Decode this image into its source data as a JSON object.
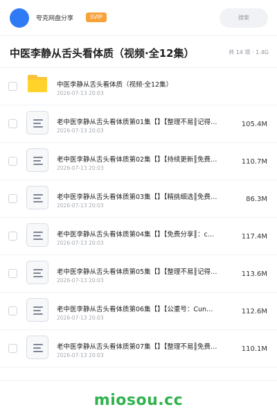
{
  "header": {
    "username": "夸克网盘分享",
    "vip_badge": "SVIP",
    "search_placeholder": "搜索"
  },
  "page": {
    "title": "中医李静从舌头看体质（视频·全12集）",
    "meta": "共 14 项 · 1.4G"
  },
  "rows": [
    {
      "type": "folder",
      "name": "中医李静从舌头看体质（视频·全12集）",
      "date": "2026-07-13 20:03",
      "size": ""
    },
    {
      "type": "file",
      "name": "老中医李静从舌头看体质第01集【】【整理不易║记得…",
      "date": "2026-07-13 20:03",
      "size": "105.4M"
    },
    {
      "type": "file",
      "name": "老中医李静从舌头看体质第02集【】【持续更新║免费…",
      "date": "2026-07-13 20:03",
      "size": "110.7M"
    },
    {
      "type": "file",
      "name": "老中医李静从舌头看体质第03集【】【精挑细选║免费…",
      "date": "2026-07-13 20:03",
      "size": "86.3M"
    },
    {
      "type": "file",
      "name": "老中医李静从舌头看体质第04集【】【免费分享║：c…",
      "date": "2026-07-13 20:03",
      "size": "117.4M"
    },
    {
      "type": "file",
      "name": "老中医李静从舌头看体质第05集【】【整理不易║记得…",
      "date": "2026-07-13 20:03",
      "size": "113.6M"
    },
    {
      "type": "file",
      "name": "老中医李静从舌头看体质第06集【】【公重号：Cun…",
      "date": "2026-07-13 20:03",
      "size": "112.6M"
    },
    {
      "type": "file",
      "name": "老中医李静从舌头看体质第07集【】【整理不易║免费…",
      "date": "2026-07-13 20:03",
      "size": "110.1M"
    }
  ],
  "footer": {
    "brand": "miosou.cc"
  },
  "colors": {
    "accent": "#2f7bf5",
    "vip": "#f7a23b",
    "folder": "#fbc531",
    "brand": "#2fb24c"
  },
  "icons": {
    "avatar": "avatar-circle",
    "folder": "folder-icon",
    "file": "document-icon",
    "checkbox": "checkbox-icon"
  }
}
